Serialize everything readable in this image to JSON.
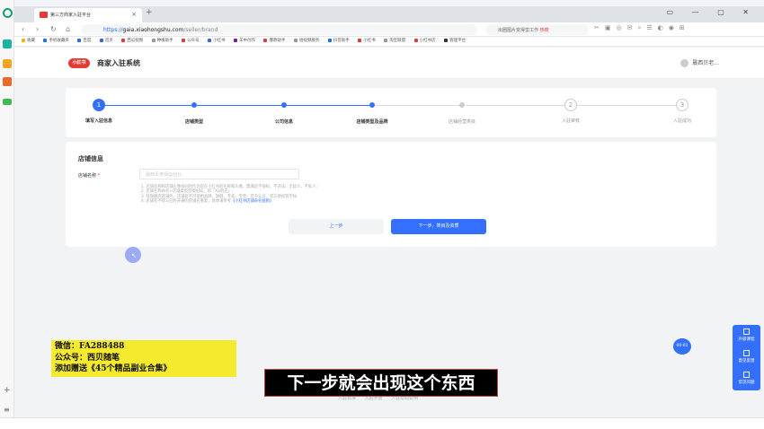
{
  "browser": {
    "tab_title": "第三方商家入驻平台",
    "tab_close": "×",
    "new_tab": "+",
    "url_scheme": "https://",
    "url_host": "gaia.xiaohongshu.com",
    "url_path": "/seller/brand",
    "search_text": "出圈图片变得蛮工作",
    "search_hot": "热搜",
    "window_controls": "▭ — ▢ ✕"
  },
  "bookmarks": [
    "收藏",
    "手机收藏夹",
    "百度",
    "首页",
    "西瓜视频",
    "种植助手",
    "公众号",
    "小红书",
    "羊中创作",
    "爆款助手",
    "短视频服务",
    "抖音助手",
    "小红书",
    "淘宝联盟",
    "小红书店",
    "管理平台"
  ],
  "app": {
    "logo_text": "小红书",
    "title": "商家入驻系统",
    "user_name": "晨西贝老..."
  },
  "steps": [
    {
      "num": "1",
      "label": "填写入驻信息",
      "state": "current"
    },
    {
      "num": "",
      "label": "店铺类型",
      "state": "done"
    },
    {
      "num": "",
      "label": "公司信息",
      "state": "done"
    },
    {
      "num": "",
      "label": "店铺类型及品牌",
      "state": "active"
    },
    {
      "num": "",
      "label": "店铺经营类目",
      "state": "pending"
    },
    {
      "num": "2",
      "label": "入驻审核",
      "state": "todo"
    },
    {
      "num": "3",
      "label": "入驻成功",
      "state": "todo"
    }
  ],
  "form": {
    "section_title": "店铺信息",
    "field_label": "店铺名称",
    "required_mark": "*",
    "placeholder": "晨西贝老师@创业",
    "hint": "1. 店铺名称和店铺头像会同时作为您在小红书的名称和头像，需满足不侵权、不违法、无歧义、不私人;\n2. 店铺名称命名+店铺类型后缀组成，如「XX的店」;\n3. 除旗舰店店铺外，店铺名不可使用品牌、旗舰、专卖、专营、官方认证、官方授权等字样;\n4. 店铺名不得与已经开通的店铺名重复，具体请参考",
    "hint_link": "《小红书店铺命名规则》",
    "prev_button": "上一步",
    "next_button": "下一步，类目及资质"
  },
  "float_bar": {
    "items": [
      "升级课程",
      "意见反馈",
      "常见问题"
    ]
  },
  "badge_text": "00:01",
  "footer": "入驻标准 入驻手册 入驻帮助说明",
  "watermark": {
    "line1": "微信：FA288488",
    "line2": "公众号：西贝随笔",
    "line3": "添加赠送《45个精品副业合集》"
  },
  "subtitle": "下一步就会出现这个东西"
}
